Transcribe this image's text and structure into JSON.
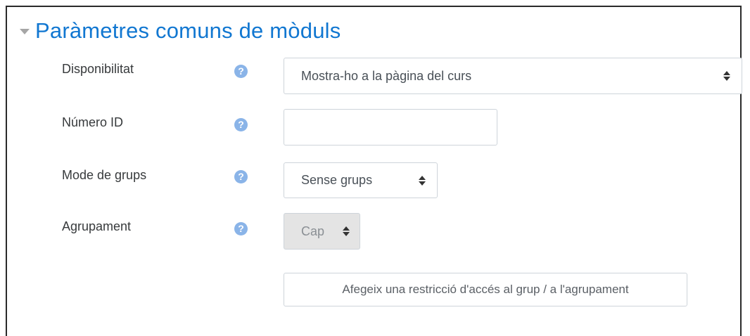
{
  "section": {
    "title": "Paràmetres comuns de mòduls"
  },
  "fields": {
    "availability": {
      "label": "Disponibilitat",
      "value": "Mostra-ho a la pàgina del curs"
    },
    "idnumber": {
      "label": "Número ID",
      "value": ""
    },
    "groupmode": {
      "label": "Mode de grups",
      "value": "Sense grups"
    },
    "grouping": {
      "label": "Agrupament",
      "value": "Cap"
    }
  },
  "restriction_button": {
    "label": "Afegeix una restricció d'accés al grup / a l'agrupament"
  },
  "colors": {
    "title": "#1177d1",
    "help_icon": "#8ab4e8",
    "disabled_bg": "#e4e4e4"
  },
  "icons": {
    "collapse": "triangle-down-icon",
    "help": "question-circle-icon",
    "select_arrows": "sort-updown-icon"
  }
}
